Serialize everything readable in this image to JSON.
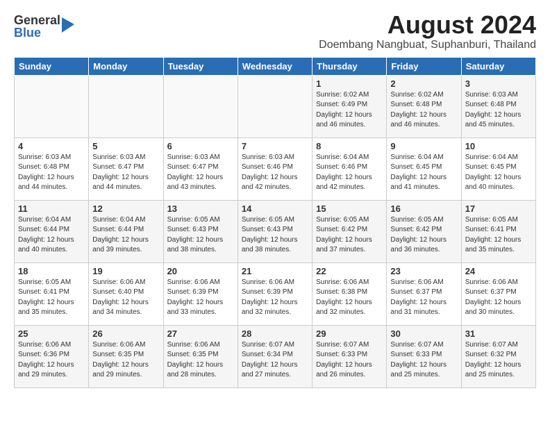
{
  "logo": {
    "general": "General",
    "blue": "Blue"
  },
  "title": {
    "month": "August 2024",
    "location": "Doembang Nangbuat, Suphanburi, Thailand"
  },
  "weekdays": [
    "Sunday",
    "Monday",
    "Tuesday",
    "Wednesday",
    "Thursday",
    "Friday",
    "Saturday"
  ],
  "weeks": [
    [
      {
        "day": "",
        "info": ""
      },
      {
        "day": "",
        "info": ""
      },
      {
        "day": "",
        "info": ""
      },
      {
        "day": "",
        "info": ""
      },
      {
        "day": "1",
        "info": "Sunrise: 6:02 AM\nSunset: 6:49 PM\nDaylight: 12 hours\nand 46 minutes."
      },
      {
        "day": "2",
        "info": "Sunrise: 6:02 AM\nSunset: 6:48 PM\nDaylight: 12 hours\nand 46 minutes."
      },
      {
        "day": "3",
        "info": "Sunrise: 6:03 AM\nSunset: 6:48 PM\nDaylight: 12 hours\nand 45 minutes."
      }
    ],
    [
      {
        "day": "4",
        "info": "Sunrise: 6:03 AM\nSunset: 6:48 PM\nDaylight: 12 hours\nand 44 minutes."
      },
      {
        "day": "5",
        "info": "Sunrise: 6:03 AM\nSunset: 6:47 PM\nDaylight: 12 hours\nand 44 minutes."
      },
      {
        "day": "6",
        "info": "Sunrise: 6:03 AM\nSunset: 6:47 PM\nDaylight: 12 hours\nand 43 minutes."
      },
      {
        "day": "7",
        "info": "Sunrise: 6:03 AM\nSunset: 6:46 PM\nDaylight: 12 hours\nand 42 minutes."
      },
      {
        "day": "8",
        "info": "Sunrise: 6:04 AM\nSunset: 6:46 PM\nDaylight: 12 hours\nand 42 minutes."
      },
      {
        "day": "9",
        "info": "Sunrise: 6:04 AM\nSunset: 6:45 PM\nDaylight: 12 hours\nand 41 minutes."
      },
      {
        "day": "10",
        "info": "Sunrise: 6:04 AM\nSunset: 6:45 PM\nDaylight: 12 hours\nand 40 minutes."
      }
    ],
    [
      {
        "day": "11",
        "info": "Sunrise: 6:04 AM\nSunset: 6:44 PM\nDaylight: 12 hours\nand 40 minutes."
      },
      {
        "day": "12",
        "info": "Sunrise: 6:04 AM\nSunset: 6:44 PM\nDaylight: 12 hours\nand 39 minutes."
      },
      {
        "day": "13",
        "info": "Sunrise: 6:05 AM\nSunset: 6:43 PM\nDaylight: 12 hours\nand 38 minutes."
      },
      {
        "day": "14",
        "info": "Sunrise: 6:05 AM\nSunset: 6:43 PM\nDaylight: 12 hours\nand 38 minutes."
      },
      {
        "day": "15",
        "info": "Sunrise: 6:05 AM\nSunset: 6:42 PM\nDaylight: 12 hours\nand 37 minutes."
      },
      {
        "day": "16",
        "info": "Sunrise: 6:05 AM\nSunset: 6:42 PM\nDaylight: 12 hours\nand 36 minutes."
      },
      {
        "day": "17",
        "info": "Sunrise: 6:05 AM\nSunset: 6:41 PM\nDaylight: 12 hours\nand 35 minutes."
      }
    ],
    [
      {
        "day": "18",
        "info": "Sunrise: 6:05 AM\nSunset: 6:41 PM\nDaylight: 12 hours\nand 35 minutes."
      },
      {
        "day": "19",
        "info": "Sunrise: 6:06 AM\nSunset: 6:40 PM\nDaylight: 12 hours\nand 34 minutes."
      },
      {
        "day": "20",
        "info": "Sunrise: 6:06 AM\nSunset: 6:39 PM\nDaylight: 12 hours\nand 33 minutes."
      },
      {
        "day": "21",
        "info": "Sunrise: 6:06 AM\nSunset: 6:39 PM\nDaylight: 12 hours\nand 32 minutes."
      },
      {
        "day": "22",
        "info": "Sunrise: 6:06 AM\nSunset: 6:38 PM\nDaylight: 12 hours\nand 32 minutes."
      },
      {
        "day": "23",
        "info": "Sunrise: 6:06 AM\nSunset: 6:37 PM\nDaylight: 12 hours\nand 31 minutes."
      },
      {
        "day": "24",
        "info": "Sunrise: 6:06 AM\nSunset: 6:37 PM\nDaylight: 12 hours\nand 30 minutes."
      }
    ],
    [
      {
        "day": "25",
        "info": "Sunrise: 6:06 AM\nSunset: 6:36 PM\nDaylight: 12 hours\nand 29 minutes."
      },
      {
        "day": "26",
        "info": "Sunrise: 6:06 AM\nSunset: 6:35 PM\nDaylight: 12 hours\nand 29 minutes."
      },
      {
        "day": "27",
        "info": "Sunrise: 6:06 AM\nSunset: 6:35 PM\nDaylight: 12 hours\nand 28 minutes."
      },
      {
        "day": "28",
        "info": "Sunrise: 6:07 AM\nSunset: 6:34 PM\nDaylight: 12 hours\nand 27 minutes."
      },
      {
        "day": "29",
        "info": "Sunrise: 6:07 AM\nSunset: 6:33 PM\nDaylight: 12 hours\nand 26 minutes."
      },
      {
        "day": "30",
        "info": "Sunrise: 6:07 AM\nSunset: 6:33 PM\nDaylight: 12 hours\nand 25 minutes."
      },
      {
        "day": "31",
        "info": "Sunrise: 6:07 AM\nSunset: 6:32 PM\nDaylight: 12 hours\nand 25 minutes."
      }
    ]
  ]
}
